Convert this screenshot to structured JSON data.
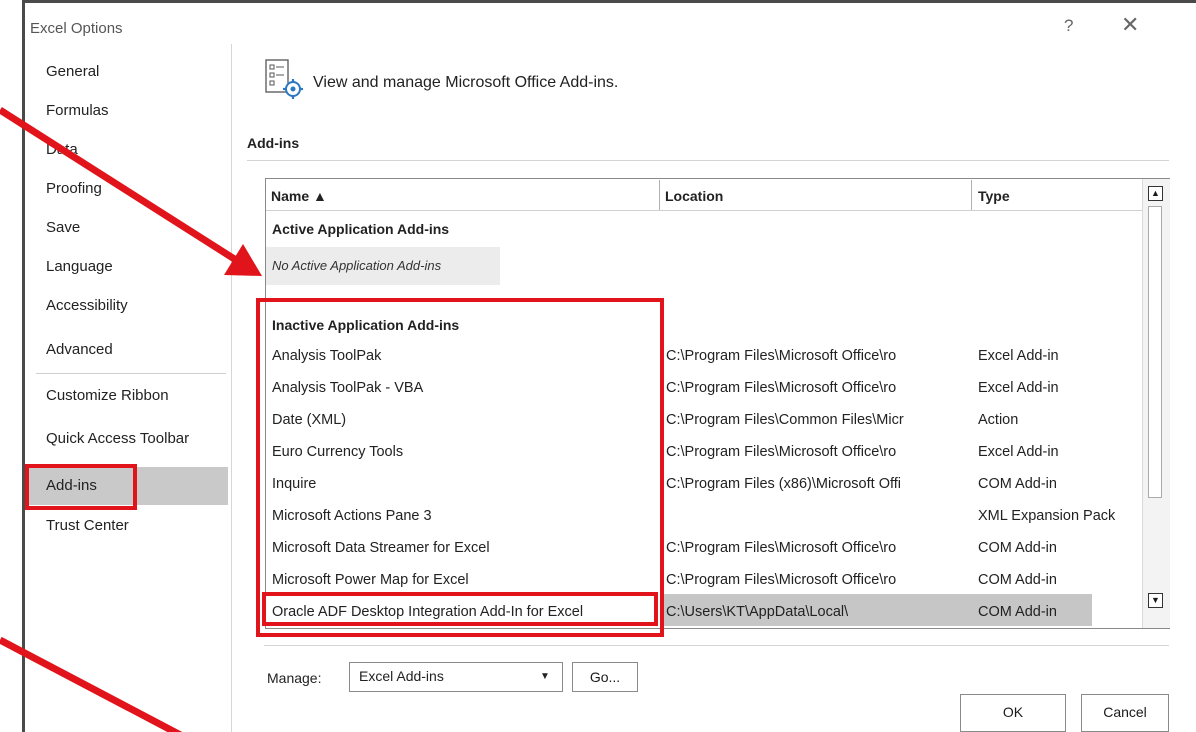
{
  "window": {
    "title": "Excel Options",
    "help_glyph": "?",
    "close_glyph": "✕"
  },
  "sidebar": {
    "items": [
      {
        "label": "General"
      },
      {
        "label": "Formulas"
      },
      {
        "label": "Data"
      },
      {
        "label": "Proofing"
      },
      {
        "label": "Save"
      },
      {
        "label": "Language"
      },
      {
        "label": "Accessibility"
      },
      {
        "label": "Advanced"
      },
      {
        "label": "Customize Ribbon"
      },
      {
        "label": "Quick Access Toolbar"
      },
      {
        "label": "Add-ins",
        "selected": true
      },
      {
        "label": "Trust Center"
      }
    ]
  },
  "main": {
    "header_text": "View and manage Microsoft Office Add-ins.",
    "header_icon": "addins-gear-icon",
    "section_title": "Add-ins"
  },
  "table": {
    "columns": [
      "Name ▲",
      "Location",
      "Type"
    ],
    "active_section": "Active Application Add-ins",
    "no_active": "No Active Application Add-ins",
    "inactive_section": "Inactive Application Add-ins",
    "rows": [
      {
        "name": "Analysis ToolPak",
        "location": "C:\\Program Files\\Microsoft Office\\ro",
        "type": "Excel Add-in"
      },
      {
        "name": "Analysis ToolPak - VBA",
        "location": "C:\\Program Files\\Microsoft Office\\ro",
        "type": "Excel Add-in"
      },
      {
        "name": "Date (XML)",
        "location": "C:\\Program Files\\Common Files\\Micr",
        "type": "Action"
      },
      {
        "name": "Euro Currency Tools",
        "location": "C:\\Program Files\\Microsoft Office\\ro",
        "type": "Excel Add-in"
      },
      {
        "name": "Inquire",
        "location": "C:\\Program Files (x86)\\Microsoft Offi",
        "type": "COM Add-in"
      },
      {
        "name": "Microsoft Actions Pane 3",
        "location": "",
        "type": "XML Expansion Pack"
      },
      {
        "name": "Microsoft Data Streamer for Excel",
        "location": "C:\\Program Files\\Microsoft Office\\ro",
        "type": "COM Add-in"
      },
      {
        "name": "Microsoft Power Map for Excel",
        "location": "C:\\Program Files\\Microsoft Office\\ro",
        "type": "COM Add-in"
      },
      {
        "name": "Oracle ADF Desktop Integration Add-In for Excel",
        "location": "C:\\Users\\KT\\AppData\\Local\\",
        "type": "COM Add-in",
        "selected": true
      }
    ]
  },
  "manage": {
    "label": "Manage:",
    "value": "Excel Add-ins",
    "go_label": "Go..."
  },
  "buttons": {
    "ok": "OK",
    "cancel": "Cancel"
  },
  "annotation_color": "#e0141a"
}
